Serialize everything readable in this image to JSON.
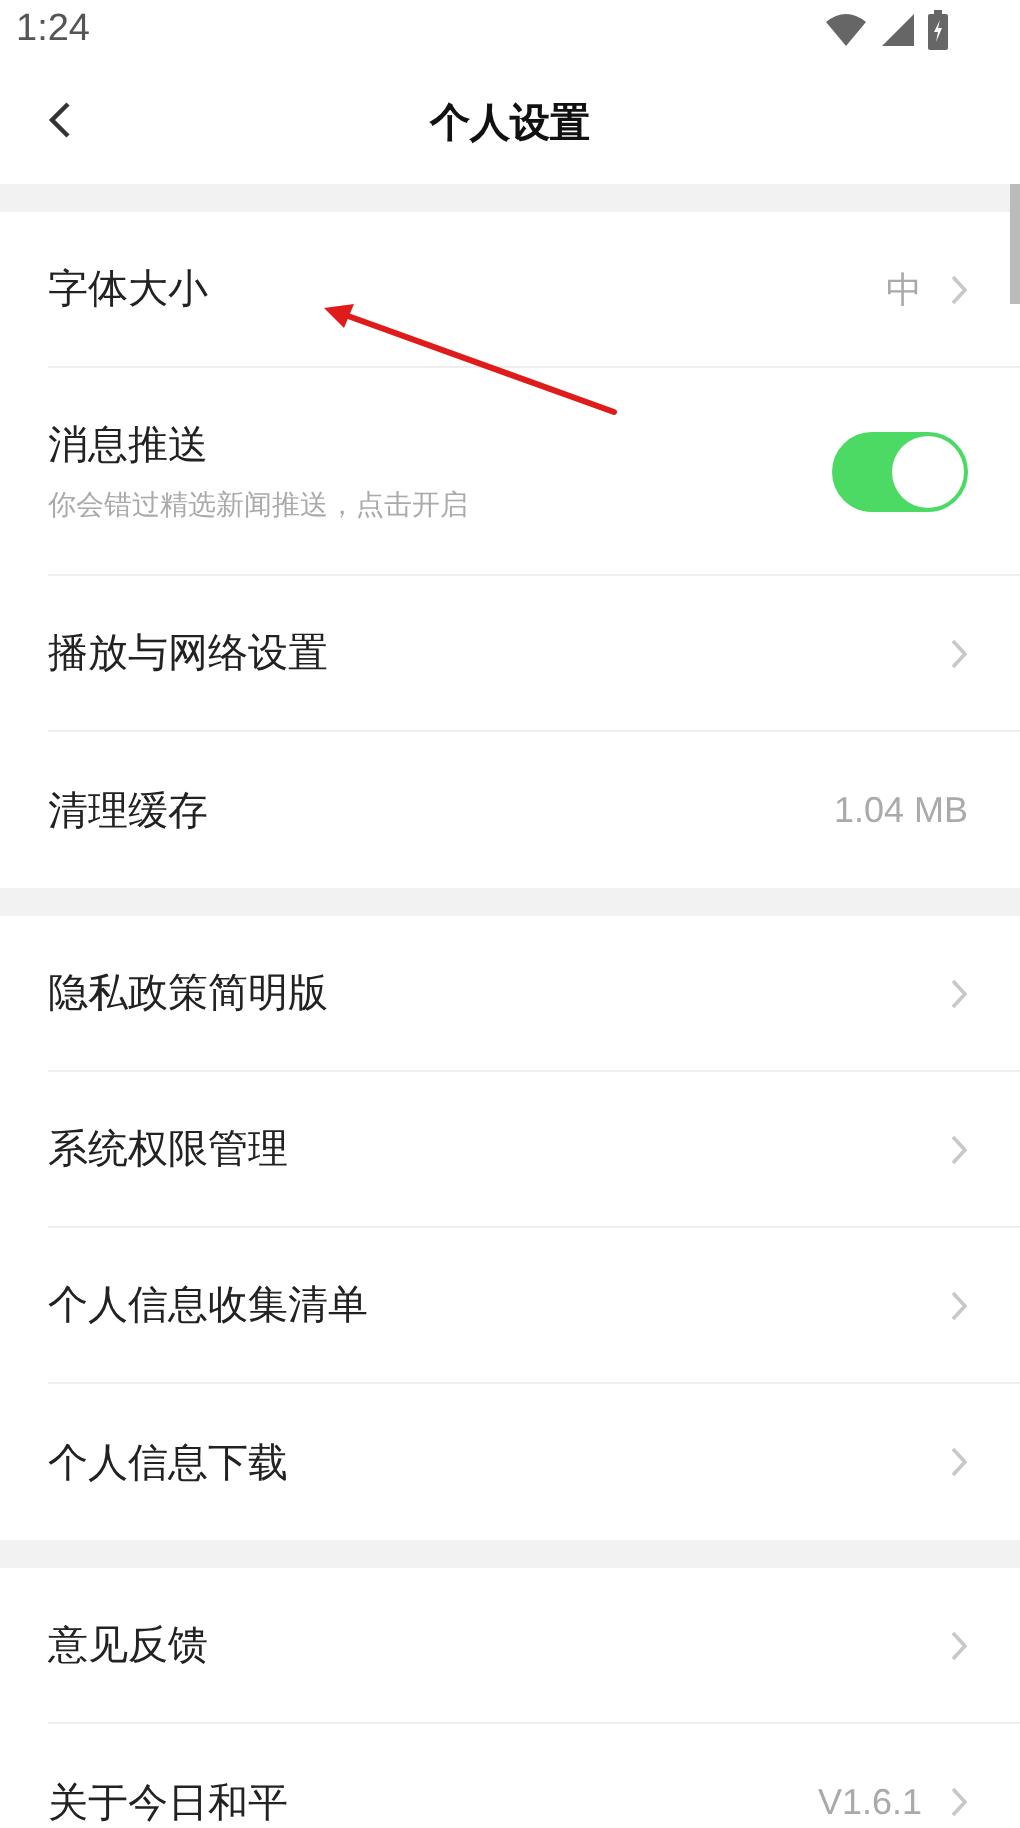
{
  "status_bar": {
    "time": "1:24"
  },
  "header": {
    "title": "个人设置"
  },
  "sections": [
    {
      "items": [
        {
          "kind": "link",
          "label": "字体大小",
          "value": "中"
        },
        {
          "kind": "toggle",
          "label": "消息推送",
          "subtitle": "你会错过精选新闻推送，点击开启",
          "on": true
        },
        {
          "kind": "link",
          "label": "播放与网络设置"
        },
        {
          "kind": "info",
          "label": "清理缓存",
          "value": "1.04 MB"
        }
      ]
    },
    {
      "items": [
        {
          "kind": "link",
          "label": "隐私政策简明版"
        },
        {
          "kind": "link",
          "label": "系统权限管理"
        },
        {
          "kind": "link",
          "label": "个人信息收集清单"
        },
        {
          "kind": "link",
          "label": "个人信息下载"
        }
      ]
    },
    {
      "items": [
        {
          "kind": "link",
          "label": "意见反馈"
        },
        {
          "kind": "link",
          "label": "关于今日和平",
          "value": "V1.6.1"
        }
      ]
    }
  ]
}
